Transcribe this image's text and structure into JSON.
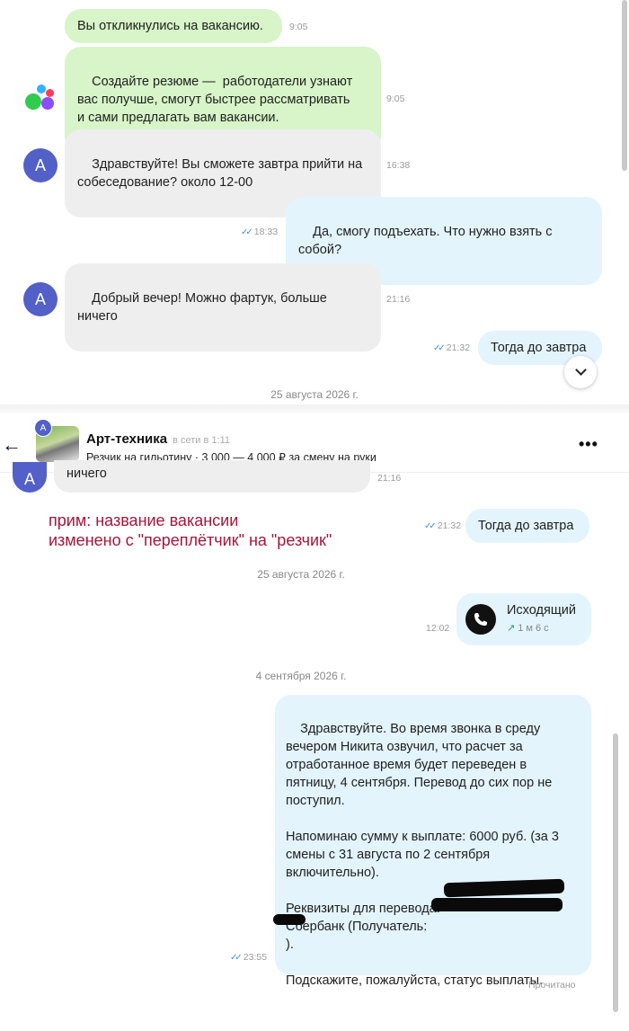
{
  "top": {
    "messages": [
      {
        "text": "Вы откликнулись на вакансию.",
        "time": "9:05"
      },
      {
        "text": "Создайте резюме —  работодатели узнают\nвас получше, смогут быстрее рассматривать\nи сами предлагать вам вакансии.",
        "time": "9:05"
      },
      {
        "text": "Здравствуйте! Вы сможете завтра прийти на\nсобеседование? около 12-00",
        "time": "16:38"
      },
      {
        "text": "Да, смогу подъехать. Что нужно взять с\nсобой?",
        "time": "18:33"
      },
      {
        "text": "Добрый вечер! Можно фартук, больше\nничего",
        "time": "21:16"
      },
      {
        "text": "Тогда до завтра",
        "time": "21:32"
      }
    ],
    "avatar_letter": "A",
    "date_sep": "25 августа 2026 г."
  },
  "header": {
    "title": "Арт-техника",
    "status": "в сети в 1:11",
    "subtitle": "Резчик на гильотину · 3 000 — 4 000 ₽ за смену на руки",
    "avatar_letter": "A",
    "back_icon": "←",
    "more_icon": "•••"
  },
  "bottom": {
    "partial_text": "ничего",
    "partial_time": "21:16",
    "note": "прим: название вакансии\nизменено с \"переплётчик\" на \"резчик\"",
    "reply": {
      "text": "Тогда до завтра",
      "time": "21:32"
    },
    "date1": "25 августа 2026 г.",
    "call": {
      "label": "Исходящий",
      "duration": "1 м 6 с",
      "time": "12:02"
    },
    "date2": "4 сентября 2026 г.",
    "long_message": "Здравствуйте. Во время звонка в среду\nвечером Никита озвучил, что расчет за\nотработанное время будет переведен в\nпятницу, 4 сентября. Перевод до сих пор не\nпоступил.\n\nНапоминаю сумму к выплате: 6000 руб. (за 3\nсмены с 31 августа по 2 сентября\nвключительно).\n\nРеквизиты для перевода: \nСбербанк (Получатель: \n).\n\nПодскажите, пожалуйста, статус выплаты.",
    "long_time": "23:55",
    "read_status": "Прочитано"
  },
  "colors": {
    "accent": "#5360c8",
    "incoming": "#eeeeee",
    "outgoing": "#e3f4fd",
    "note": "#a4163a"
  }
}
